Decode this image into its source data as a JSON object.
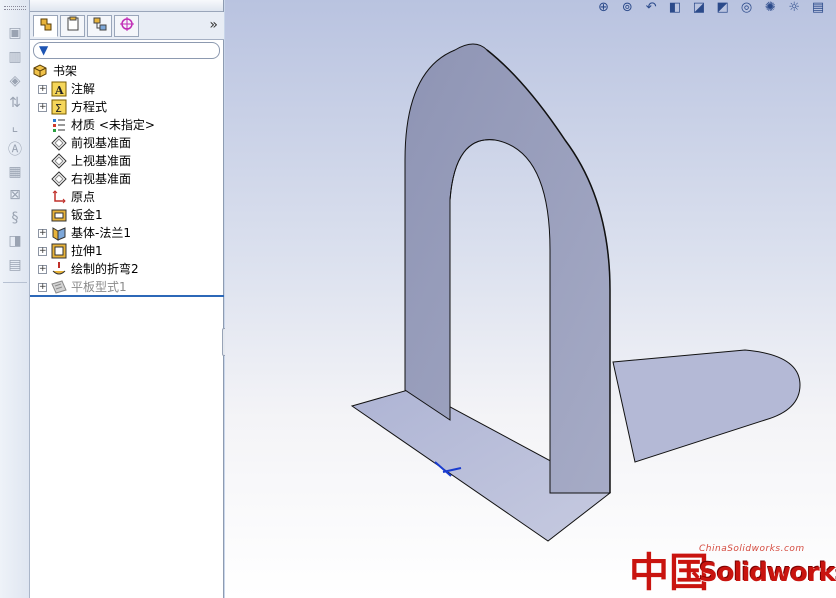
{
  "tree": {
    "root_label": "书架",
    "items": [
      {
        "label": "注解",
        "icon": "annotations-icon",
        "expandable": true
      },
      {
        "label": "方程式",
        "icon": "equations-icon",
        "expandable": true
      },
      {
        "label": "材质 <未指定>",
        "icon": "material-icon",
        "expandable": false
      },
      {
        "label": "前视基准面",
        "icon": "plane-icon",
        "expandable": false
      },
      {
        "label": "上视基准面",
        "icon": "plane-icon",
        "expandable": false
      },
      {
        "label": "右视基准面",
        "icon": "plane-icon",
        "expandable": false
      },
      {
        "label": "原点",
        "icon": "origin-icon",
        "expandable": false
      },
      {
        "label": "钣金1",
        "icon": "sheet-metal-icon",
        "expandable": false
      },
      {
        "label": "基体-法兰1",
        "icon": "base-flange-icon",
        "expandable": true
      },
      {
        "label": "拉伸1",
        "icon": "extrude-icon",
        "expandable": true
      },
      {
        "label": "绘制的折弯2",
        "icon": "sketched-bend-icon",
        "expandable": true
      },
      {
        "label": "平板型式1",
        "icon": "flat-pattern-icon",
        "expandable": true,
        "suppressed": true
      }
    ]
  },
  "tabs": [
    {
      "name": "feature-manager",
      "icon": "feature-tree-icon",
      "active": true
    },
    {
      "name": "property-manager",
      "icon": "property-manager-icon"
    },
    {
      "name": "configuration-manager",
      "icon": "configuration-icon"
    },
    {
      "name": "dimxpert-manager",
      "icon": "dimxpert-icon"
    }
  ],
  "expand_glyph": "»",
  "heads_up_icons": [
    "zoom-to-fit-icon",
    "zoom-area-icon",
    "previous-view-icon",
    "section-view-icon",
    "view-orientation-icon",
    "display-style-icon",
    "hide-show-items-icon",
    "edit-appearance-icon",
    "apply-scene-icon",
    "view-settings-icon"
  ],
  "watermark": {
    "zh": "中国",
    "brand": "Solidworks",
    "url": "ChinaSolidworks.com"
  },
  "colors": {
    "panel_bg": "#ffffff",
    "rollback_bar": "#2c68b8",
    "part_fill": "#9ea4c2",
    "part_edge": "#111111",
    "watermark_red": "#c9140f"
  }
}
